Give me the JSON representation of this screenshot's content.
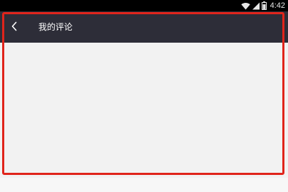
{
  "status_bar": {
    "time": "4:42",
    "icons": [
      "wifi-icon",
      "signal-icon",
      "battery-icon"
    ]
  },
  "app_bar": {
    "back_icon": "chevron-left-icon",
    "title": "我的评论"
  },
  "colors": {
    "status_bar_bg": "#000000",
    "app_bar_bg": "#2d2d38",
    "content_bg": "#f2f2f2",
    "highlight_border": "#e0241b"
  }
}
